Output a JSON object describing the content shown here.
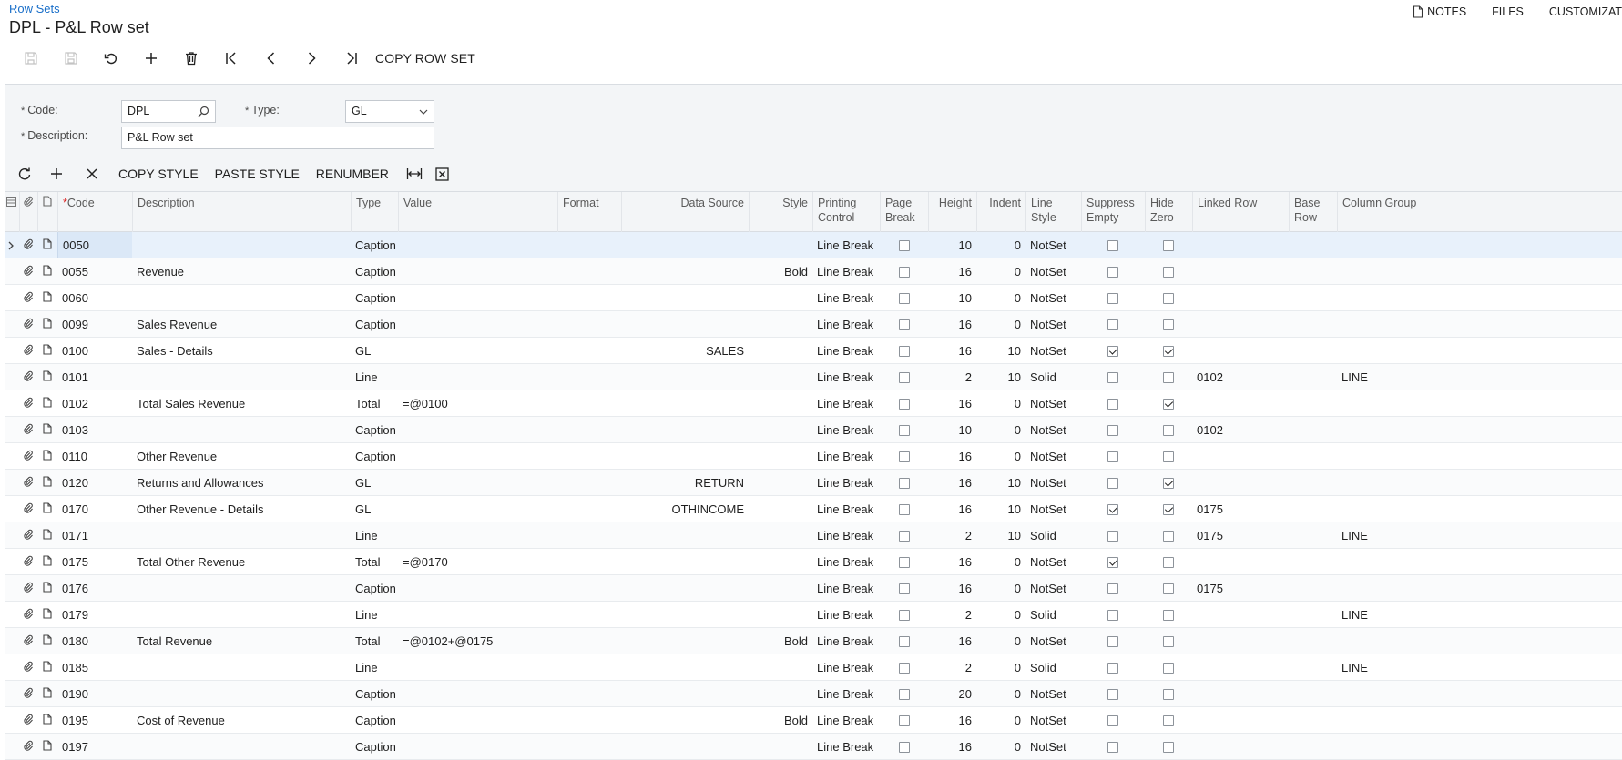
{
  "header": {
    "breadcrumb": "Row Sets",
    "title": "DPL - P&L Row set",
    "actions": {
      "notes": "NOTES",
      "files": "FILES",
      "customization": "CUSTOMIZAT"
    }
  },
  "toolbar": {
    "copy_row_set": "COPY ROW SET"
  },
  "form": {
    "code_label": "Code:",
    "code_value": "DPL",
    "type_label": "Type:",
    "type_value": "GL",
    "description_label": "Description:",
    "description_value": "P&L Row set",
    "required_mark": "*"
  },
  "grid_toolbar": {
    "copy_style": "COPY STYLE",
    "paste_style": "PASTE STYLE",
    "renumber": "RENUMBER"
  },
  "columns": {
    "code": "Code",
    "code_required": "*",
    "description": "Description",
    "type": "Type",
    "value": "Value",
    "format": "Format",
    "data_source": "Data Source",
    "style": "Style",
    "printing_control_1": "Printing",
    "printing_control_2": "Control",
    "page_break_1": "Page",
    "page_break_2": "Break",
    "height": "Height",
    "indent": "Indent",
    "line_style_1": "Line",
    "line_style_2": "Style",
    "suppress_empty_1": "Suppress",
    "suppress_empty_2": "Empty",
    "hide_zero_1": "Hide",
    "hide_zero_2": "Zero",
    "linked_row": "Linked Row",
    "base_row_1": "Base",
    "base_row_2": "Row",
    "column_group": "Column Group"
  },
  "rows": [
    {
      "code": "0050",
      "description": "",
      "type": "Caption",
      "value": "",
      "data_source": "",
      "style": "",
      "printing": "Line Break",
      "page_break": false,
      "height": "10",
      "indent": "0",
      "line_style": "NotSet",
      "suppress_empty": false,
      "hide_zero": false,
      "linked_row": "",
      "column_group": ""
    },
    {
      "code": "0055",
      "description": "Revenue",
      "type": "Caption",
      "value": "",
      "data_source": "",
      "style": "Bold",
      "printing": "Line Break",
      "page_break": false,
      "height": "16",
      "indent": "0",
      "line_style": "NotSet",
      "suppress_empty": false,
      "hide_zero": false,
      "linked_row": "",
      "column_group": ""
    },
    {
      "code": "0060",
      "description": "",
      "type": "Caption",
      "value": "",
      "data_source": "",
      "style": "",
      "printing": "Line Break",
      "page_break": false,
      "height": "10",
      "indent": "0",
      "line_style": "NotSet",
      "suppress_empty": false,
      "hide_zero": false,
      "linked_row": "",
      "column_group": ""
    },
    {
      "code": "0099",
      "description": "Sales Revenue",
      "type": "Caption",
      "value": "",
      "data_source": "",
      "style": "",
      "printing": "Line Break",
      "page_break": false,
      "height": "16",
      "indent": "0",
      "line_style": "NotSet",
      "suppress_empty": false,
      "hide_zero": false,
      "linked_row": "",
      "column_group": ""
    },
    {
      "code": "0100",
      "description": "Sales - Details",
      "type": "GL",
      "value": "",
      "data_source": "SALES",
      "style": "",
      "printing": "Line Break",
      "page_break": false,
      "height": "16",
      "indent": "10",
      "line_style": "NotSet",
      "suppress_empty": true,
      "hide_zero": true,
      "linked_row": "",
      "column_group": ""
    },
    {
      "code": "0101",
      "description": "",
      "type": "Line",
      "value": "",
      "data_source": "",
      "style": "",
      "printing": "Line Break",
      "page_break": false,
      "height": "2",
      "indent": "10",
      "line_style": "Solid",
      "suppress_empty": false,
      "hide_zero": false,
      "linked_row": "0102",
      "column_group": "LINE"
    },
    {
      "code": "0102",
      "description": "Total Sales Revenue",
      "type": "Total",
      "value": "=@0100",
      "data_source": "",
      "style": "",
      "printing": "Line Break",
      "page_break": false,
      "height": "16",
      "indent": "0",
      "line_style": "NotSet",
      "suppress_empty": false,
      "hide_zero": true,
      "linked_row": "",
      "column_group": ""
    },
    {
      "code": "0103",
      "description": "",
      "type": "Caption",
      "value": "",
      "data_source": "",
      "style": "",
      "printing": "Line Break",
      "page_break": false,
      "height": "10",
      "indent": "0",
      "line_style": "NotSet",
      "suppress_empty": false,
      "hide_zero": false,
      "linked_row": "0102",
      "column_group": ""
    },
    {
      "code": "0110",
      "description": "Other Revenue",
      "type": "Caption",
      "value": "",
      "data_source": "",
      "style": "",
      "printing": "Line Break",
      "page_break": false,
      "height": "16",
      "indent": "0",
      "line_style": "NotSet",
      "suppress_empty": false,
      "hide_zero": false,
      "linked_row": "",
      "column_group": ""
    },
    {
      "code": "0120",
      "description": "Returns and Allowances",
      "type": "GL",
      "value": "",
      "data_source": "RETURN",
      "style": "",
      "printing": "Line Break",
      "page_break": false,
      "height": "16",
      "indent": "10",
      "line_style": "NotSet",
      "suppress_empty": false,
      "hide_zero": true,
      "linked_row": "",
      "column_group": ""
    },
    {
      "code": "0170",
      "description": "Other Revenue - Details",
      "type": "GL",
      "value": "",
      "data_source": "OTHINCOME",
      "style": "",
      "printing": "Line Break",
      "page_break": false,
      "height": "16",
      "indent": "10",
      "line_style": "NotSet",
      "suppress_empty": true,
      "hide_zero": true,
      "linked_row": "0175",
      "column_group": ""
    },
    {
      "code": "0171",
      "description": "",
      "type": "Line",
      "value": "",
      "data_source": "",
      "style": "",
      "printing": "Line Break",
      "page_break": false,
      "height": "2",
      "indent": "10",
      "line_style": "Solid",
      "suppress_empty": false,
      "hide_zero": false,
      "linked_row": "0175",
      "column_group": "LINE"
    },
    {
      "code": "0175",
      "description": "Total Other Revenue",
      "type": "Total",
      "value": "=@0170",
      "data_source": "",
      "style": "",
      "printing": "Line Break",
      "page_break": false,
      "height": "16",
      "indent": "0",
      "line_style": "NotSet",
      "suppress_empty": true,
      "hide_zero": false,
      "linked_row": "",
      "column_group": ""
    },
    {
      "code": "0176",
      "description": "",
      "type": "Caption",
      "value": "",
      "data_source": "",
      "style": "",
      "printing": "Line Break",
      "page_break": false,
      "height": "16",
      "indent": "0",
      "line_style": "NotSet",
      "suppress_empty": false,
      "hide_zero": false,
      "linked_row": "0175",
      "column_group": ""
    },
    {
      "code": "0179",
      "description": "",
      "type": "Line",
      "value": "",
      "data_source": "",
      "style": "",
      "printing": "Line Break",
      "page_break": false,
      "height": "2",
      "indent": "0",
      "line_style": "Solid",
      "suppress_empty": false,
      "hide_zero": false,
      "linked_row": "",
      "column_group": "LINE"
    },
    {
      "code": "0180",
      "description": "Total Revenue",
      "type": "Total",
      "value": "=@0102+@0175",
      "data_source": "",
      "style": "Bold",
      "printing": "Line Break",
      "page_break": false,
      "height": "16",
      "indent": "0",
      "line_style": "NotSet",
      "suppress_empty": false,
      "hide_zero": false,
      "linked_row": "",
      "column_group": ""
    },
    {
      "code": "0185",
      "description": "",
      "type": "Line",
      "value": "",
      "data_source": "",
      "style": "",
      "printing": "Line Break",
      "page_break": false,
      "height": "2",
      "indent": "0",
      "line_style": "Solid",
      "suppress_empty": false,
      "hide_zero": false,
      "linked_row": "",
      "column_group": "LINE"
    },
    {
      "code": "0190",
      "description": "",
      "type": "Caption",
      "value": "",
      "data_source": "",
      "style": "",
      "printing": "Line Break",
      "page_break": false,
      "height": "20",
      "indent": "0",
      "line_style": "NotSet",
      "suppress_empty": false,
      "hide_zero": false,
      "linked_row": "",
      "column_group": ""
    },
    {
      "code": "0195",
      "description": "Cost of Revenue",
      "type": "Caption",
      "value": "",
      "data_source": "",
      "style": "Bold",
      "printing": "Line Break",
      "page_break": false,
      "height": "16",
      "indent": "0",
      "line_style": "NotSet",
      "suppress_empty": false,
      "hide_zero": false,
      "linked_row": "",
      "column_group": ""
    },
    {
      "code": "0197",
      "description": "",
      "type": "Caption",
      "value": "",
      "data_source": "",
      "style": "",
      "printing": "Line Break",
      "page_break": false,
      "height": "16",
      "indent": "0",
      "line_style": "NotSet",
      "suppress_empty": false,
      "hide_zero": false,
      "linked_row": "",
      "column_group": ""
    }
  ],
  "colors": {
    "link": "#1a6fc9",
    "selected_row": "#e8f1fb",
    "header_bg": "#f3f5f7",
    "required": "#dd2222"
  }
}
